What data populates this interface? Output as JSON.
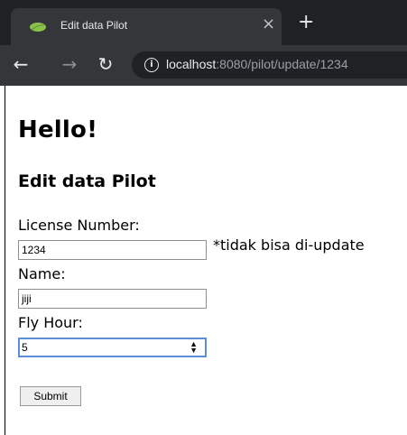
{
  "browser": {
    "tab_title": "Edit data Pilot",
    "close_glyph": "×",
    "new_tab_glyph": "+",
    "url_host": "localhost",
    "url_path": ":8080/pilot/update/1234"
  },
  "page": {
    "heading": "Hello!",
    "subheading": "Edit data Pilot",
    "license_label": "License Number:",
    "license_value": "1234",
    "license_note": "*tidak bisa di-update",
    "name_label": "Name:",
    "name_value": "jiji",
    "fly_hour_label": "Fly Hour:",
    "fly_hour_value": "5",
    "submit_label": "Submit"
  }
}
